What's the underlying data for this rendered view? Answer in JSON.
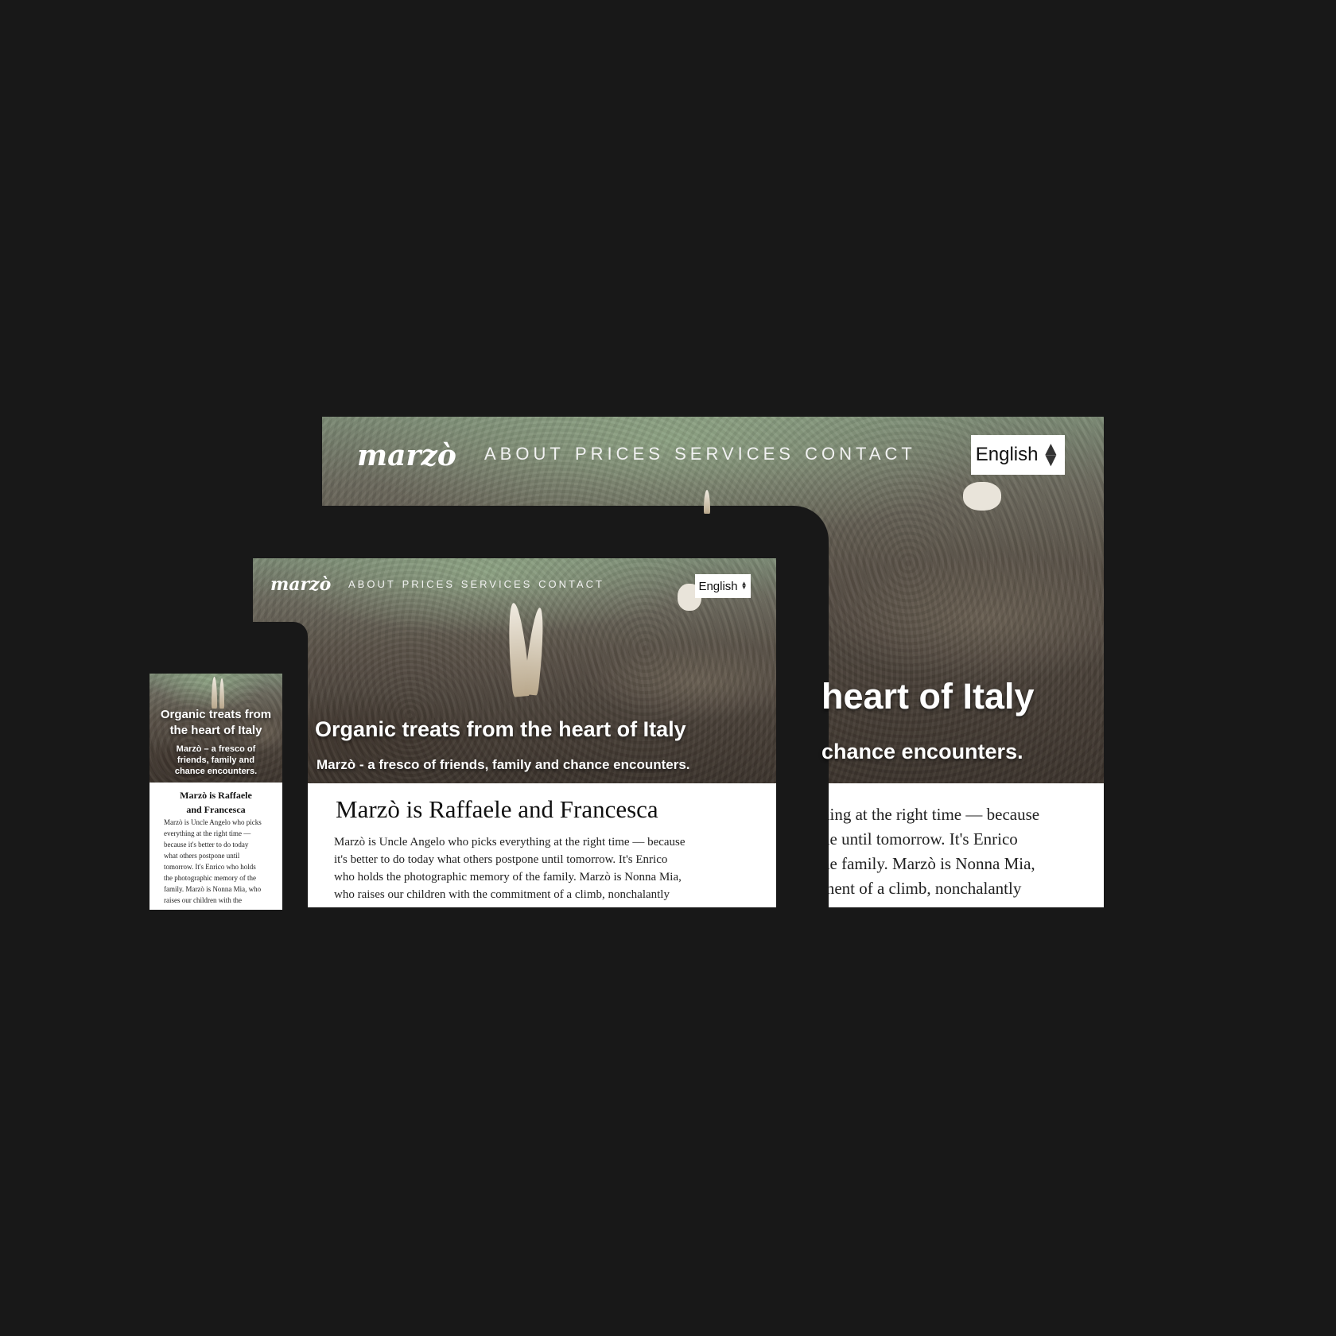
{
  "brand": "marzò",
  "nav": [
    "ABOUT",
    "PRICES",
    "SERVICES",
    "CONTACT"
  ],
  "language": "English",
  "hero": {
    "title": "Organic treats from the heart of Italy",
    "subtitle": "Marzò - a fresco of friends, family and chance encounters.",
    "title_large_visible": "heart of Italy",
    "subtitle_large_visible": "chance encounters.",
    "title_mobile_line1": "Organic treats from",
    "title_mobile_line2": "the heart of Italy",
    "subtitle_mobile_line1": "Marzò – a fresco of",
    "subtitle_mobile_line2": "friends, family and",
    "subtitle_mobile_line3": "chance encounters."
  },
  "content": {
    "title": "Marzò is Raffaele and Francesca",
    "title_mobile_line1": "Marzò is Raffaele",
    "title_mobile_line2": "and Francesca",
    "tablet_lines": [
      "Marzò is Uncle Angelo who picks everything at the right time — because",
      "it's better to do today what others postpone until tomorrow. It's Enrico",
      "who holds the photographic memory of the family. Marzò is Nonna Mia,",
      "who raises our children with the commitment of a climb, nonchalantly"
    ],
    "desktop_lines": [
      "hing at the right time — because",
      "ne until tomorrow. It's Enrico",
      "he family. Marzò is Nonna Mia,",
      "ment of a climb, nonchalantly"
    ],
    "mobile_lines": [
      "Marzò is Uncle Angelo who picks",
      "everything at the right time —",
      "because it's better to do today",
      "what others postpone until",
      "tomorrow. It's Enrico who holds",
      "the photographic memory of the",
      "family. Marzò is Nonna Mia, who",
      "raises our children with the"
    ]
  }
}
